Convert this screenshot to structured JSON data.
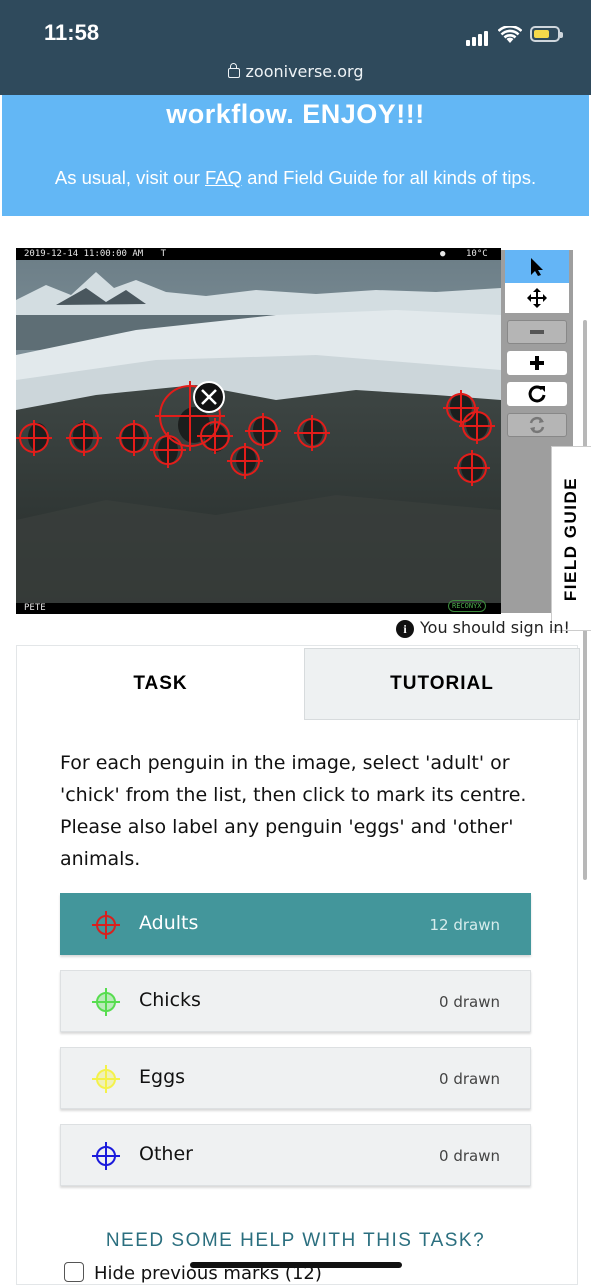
{
  "status_bar": {
    "time": "11:58",
    "url": "zooniverse.org"
  },
  "banner": {
    "headline": "workflow. ENJOY!!!",
    "sub_before": "As usual, visit our ",
    "sub_link": "FAQ",
    "sub_after": " and Field Guide for all kinds of tips."
  },
  "camera_overlay": {
    "datetime": "2019-12-14  11:00:00  AM",
    "flag": "T",
    "temperature": "10°C",
    "site": "PETE",
    "brand": "RECONYX"
  },
  "toolbar": {
    "tools": [
      "pointer-tool",
      "pan-tool",
      "zoom-out",
      "zoom-in",
      "rotate",
      "reset"
    ],
    "active_tool": "pointer-tool"
  },
  "field_guide": {
    "label": "FIELD GUIDE"
  },
  "sign_in_notice": "You should sign in!",
  "tabs": {
    "task": "TASK",
    "tutorial": "TUTORIAL"
  },
  "instructions": "For each penguin in the image, select 'adult' or 'chick' from the list, then click to mark its centre. Please also label any penguin 'eggs' and 'other' animals.",
  "options": [
    {
      "label": "Adults",
      "count": "12 drawn",
      "color": "#d9201e"
    },
    {
      "label": "Chicks",
      "count": "0 drawn",
      "color": "#57dd4f"
    },
    {
      "label": "Eggs",
      "count": "0 drawn",
      "color": "#f4f24a"
    },
    {
      "label": "Other",
      "count": "0 drawn",
      "color": "#1a1adc"
    }
  ],
  "help_link": "NEED SOME HELP WITH THIS TASK?",
  "hide_marks_label": "Hide previous marks (12)"
}
